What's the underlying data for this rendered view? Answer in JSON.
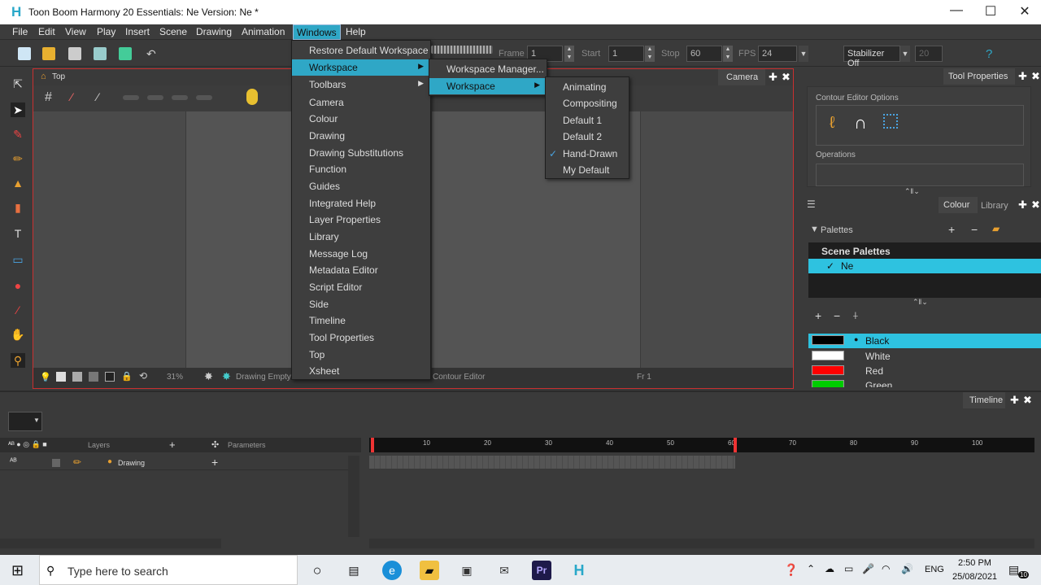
{
  "window": {
    "title": "Toon Boom Harmony 20 Essentials: Ne Version: Ne *",
    "minimize": "—",
    "maximize": "☐",
    "close": "✕",
    "logo": "H"
  },
  "menubar": [
    "File",
    "Edit",
    "View",
    "Play",
    "Insert",
    "Scene",
    "Drawing",
    "Animation",
    "Windows",
    "Help"
  ],
  "toolbar": {
    "frame_label": "Frame",
    "frame_value": "1",
    "start_label": "Start",
    "start_value": "1",
    "stop_label": "Stop",
    "stop_value": "60",
    "fps_label": "FPS",
    "fps_value": "24",
    "stabilizer": "Stabilizer Off",
    "stabilizer_value": "20"
  },
  "view": {
    "tab_top": "Top",
    "tab_camera": "Camera",
    "zoom": "31%",
    "status_drawing": "Drawing Empty",
    "status_contour": "Contour Editor",
    "status_frame": "Fr 1"
  },
  "windows_menu": {
    "items": [
      "Restore Default Workspace",
      "Workspace",
      "Toolbars",
      "Camera",
      "Colour",
      "Drawing",
      "Drawing Substitutions",
      "Function",
      "Guides",
      "Integrated Help",
      "Layer Properties",
      "Library",
      "Message Log",
      "Metadata Editor",
      "Script Editor",
      "Side",
      "Timeline",
      "Tool Properties",
      "Top",
      "Xsheet"
    ]
  },
  "workspace_menu": {
    "items": [
      "Workspace Manager...",
      "Workspace"
    ]
  },
  "workspace_submenu": {
    "items": [
      "Animating",
      "Compositing",
      "Default 1",
      "Default 2",
      "Hand-Drawn",
      "My Default"
    ],
    "checked": "Hand-Drawn",
    "checkmark": "✓"
  },
  "tool_properties": {
    "tab": "Tool Properties",
    "contour_options": "Contour Editor Options",
    "operations": "Operations"
  },
  "colour": {
    "tab_colour": "Colour",
    "tab_library": "Library",
    "palettes": "Palettes",
    "scene_palettes": "Scene Palettes",
    "palette": "Ne",
    "palette_check": "✓",
    "swatches": [
      {
        "name": "Black",
        "color": "#000000"
      },
      {
        "name": "White",
        "color": "#ffffff"
      },
      {
        "name": "Red",
        "color": "#ff0000"
      },
      {
        "name": "Green",
        "color": "#00cc00"
      }
    ]
  },
  "timeline": {
    "tab": "Timeline",
    "layers_label": "Layers",
    "parameters_label": "Parameters",
    "layer_name": "Drawing",
    "ticks": [
      "10",
      "20",
      "30",
      "40",
      "50",
      "60",
      "70",
      "80",
      "90",
      "100"
    ]
  },
  "taskbar": {
    "search_placeholder": "Type here to search",
    "time": "2:50 PM",
    "date": "25/08/2021",
    "lang": "ENG",
    "notif": "10"
  }
}
